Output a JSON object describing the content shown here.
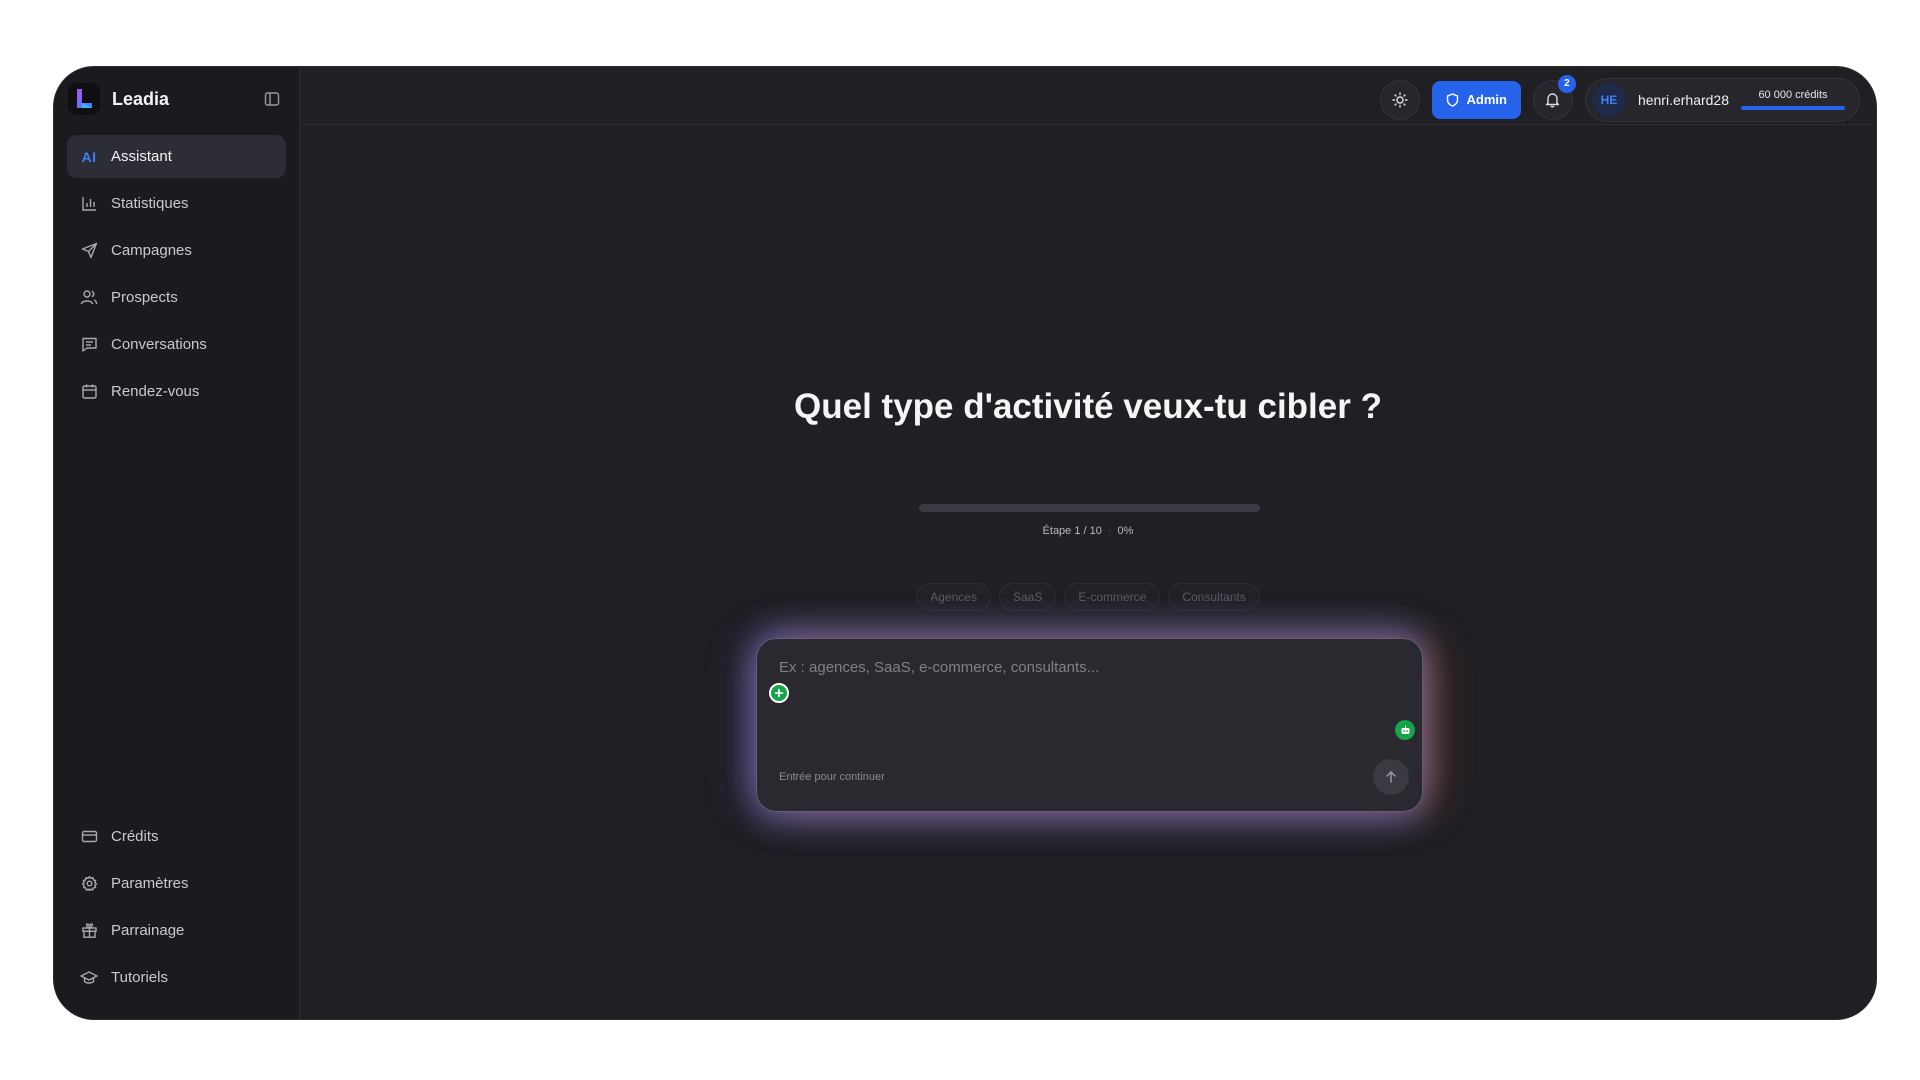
{
  "brand": {
    "name": "Leadia",
    "logo_icon": "leadia-logo-icon"
  },
  "sidebar": {
    "items": [
      {
        "key": "assistant",
        "label": "Assistant",
        "icon": "ai-badge-icon",
        "active": true
      },
      {
        "key": "statistiques",
        "label": "Statistiques",
        "icon": "bar-chart-icon",
        "active": false
      },
      {
        "key": "campagnes",
        "label": "Campagnes",
        "icon": "send-icon",
        "active": false
      },
      {
        "key": "prospects",
        "label": "Prospects",
        "icon": "users-icon",
        "active": false
      },
      {
        "key": "conversations",
        "label": "Conversations",
        "icon": "message-square-icon",
        "active": false
      },
      {
        "key": "rendez-vous",
        "label": "Rendez-vous",
        "icon": "calendar-icon",
        "active": false
      }
    ],
    "ai_mark": "AI",
    "bottom_items": [
      {
        "key": "credits",
        "label": "Crédits",
        "icon": "credit-card-icon"
      },
      {
        "key": "parametres",
        "label": "Paramètres",
        "icon": "gear-icon"
      },
      {
        "key": "parrainage",
        "label": "Parrainage",
        "icon": "gift-icon"
      },
      {
        "key": "tutoriels",
        "label": "Tutoriels",
        "icon": "graduation-cap-icon"
      }
    ]
  },
  "topbar": {
    "theme_icon": "sun-icon",
    "admin_label": "Admin",
    "admin_icon": "shield-icon",
    "notifications_count": "2",
    "notifications_icon": "bell-icon",
    "user": {
      "initials": "HE",
      "username": "henri.erhard28",
      "credits_label": "60 000 crédits",
      "credits_fill_percent": 100
    }
  },
  "wizard": {
    "question": "Quel type d'activité veux-tu cibler ?",
    "step_label": "Étape 1 / 10",
    "percent_label": "0%",
    "progress_percent": 0,
    "chips": [
      "Agences",
      "SaaS",
      "E-commerce",
      "Consultants"
    ],
    "input_placeholder": "Ex : agences, SaaS, e-commerce, consultants...",
    "input_value": "",
    "hint": "Entrée pour continuer",
    "send_icon": "arrow-up-icon"
  },
  "colors": {
    "accent": "#2563eb",
    "background": "#1f1f24",
    "sidebar": "#1a1a1f",
    "active_item": "#2c2d36"
  }
}
